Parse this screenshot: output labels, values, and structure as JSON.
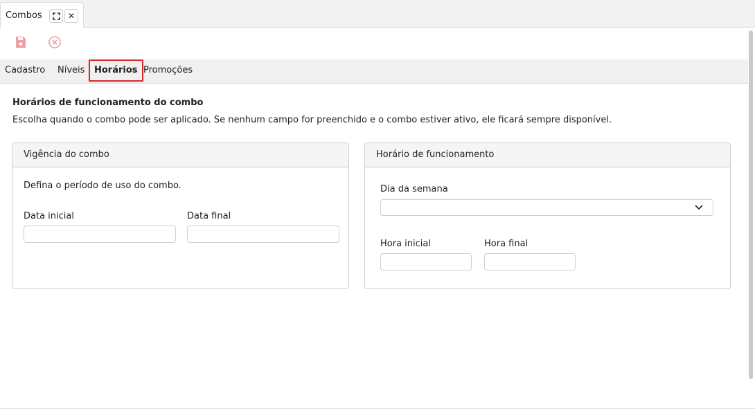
{
  "window_tab": {
    "title": "Combos",
    "maximize_icon": "maximize-icon",
    "close_icon": "close-icon",
    "close_glyph": "✕"
  },
  "toolbar": {
    "save_icon": "save-icon",
    "cancel_icon": "cancel-icon",
    "icon_color": "#f0a0a0"
  },
  "subtabs": [
    {
      "label": "Cadastro"
    },
    {
      "label": "Níveis"
    },
    {
      "label": "Horários",
      "active": true
    },
    {
      "label": "Promoções"
    }
  ],
  "active_tab_border_color": "#d9262c",
  "main": {
    "heading": "Horários de funcionamento do combo",
    "description": "Escolha quando o combo pode ser aplicado. Se nenhum campo for preenchido e o combo estiver ativo, ele ficará sempre disponível."
  },
  "vigencia": {
    "title": "Vigência do combo",
    "text": "Defina o período de uso do combo.",
    "start_label": "Data inicial",
    "start_value": "",
    "end_label": "Data final",
    "end_value": "",
    "calendar_icon": "calendar-icon"
  },
  "horario": {
    "title": "Horário de funcionamento",
    "weekday_label": "Dia da semana",
    "weekday_value": "",
    "start_label": "Hora inicial",
    "start_value": "",
    "end_label": "Hora final",
    "end_value": ""
  }
}
